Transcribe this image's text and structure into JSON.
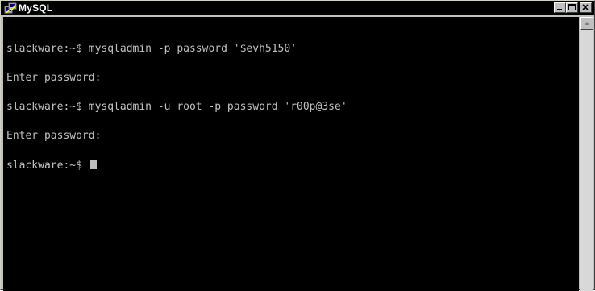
{
  "window": {
    "title": "MySQL",
    "app_icon": "putty-terminal-icon",
    "controls": {
      "minimize_icon": "minimize-icon",
      "maximize_icon": "maximize-icon",
      "close_icon": "close-icon"
    }
  },
  "terminal": {
    "lines": [
      "slackware:~$ mysqladmin -p password '$evh5150'",
      "Enter password:",
      "slackware:~$ mysqladmin -u root -p password 'r00p@3se'",
      "Enter password:",
      "slackware:~$ "
    ],
    "colors": {
      "background": "#000000",
      "foreground": "#c0c0c0"
    }
  },
  "scrollbar": {
    "up_icon": "scroll-up-arrow-icon"
  }
}
